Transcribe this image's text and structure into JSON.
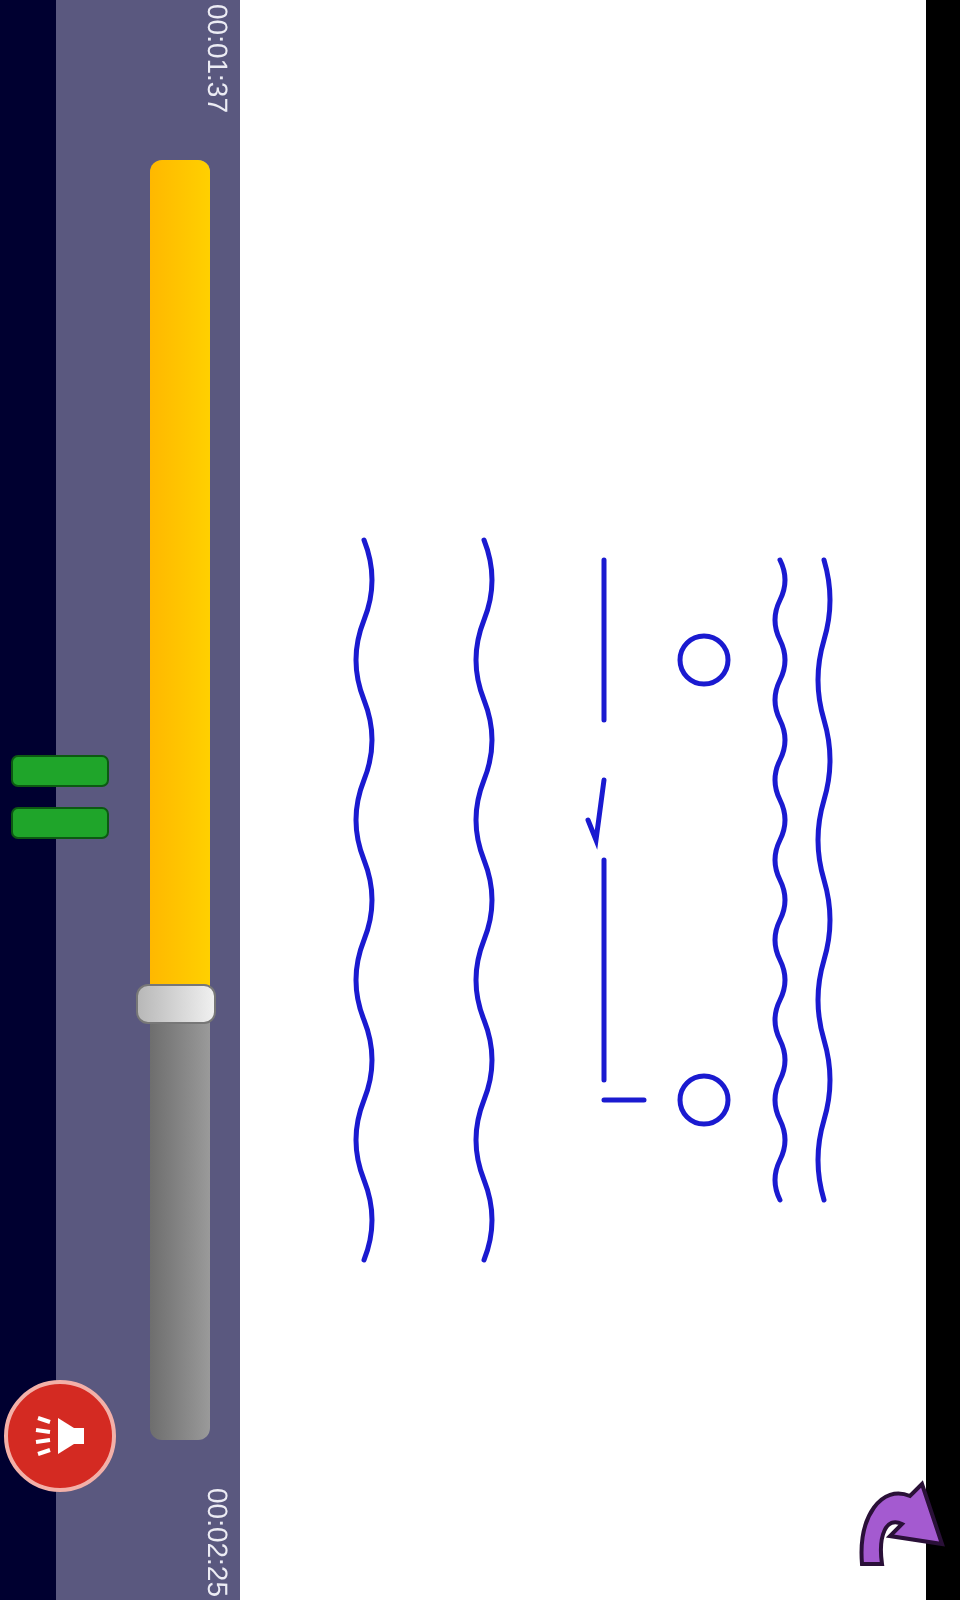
{
  "player": {
    "elapsed": "00:01:37",
    "total": "00:02:25",
    "playing": true,
    "progress": {
      "level": 0.66
    }
  }
}
